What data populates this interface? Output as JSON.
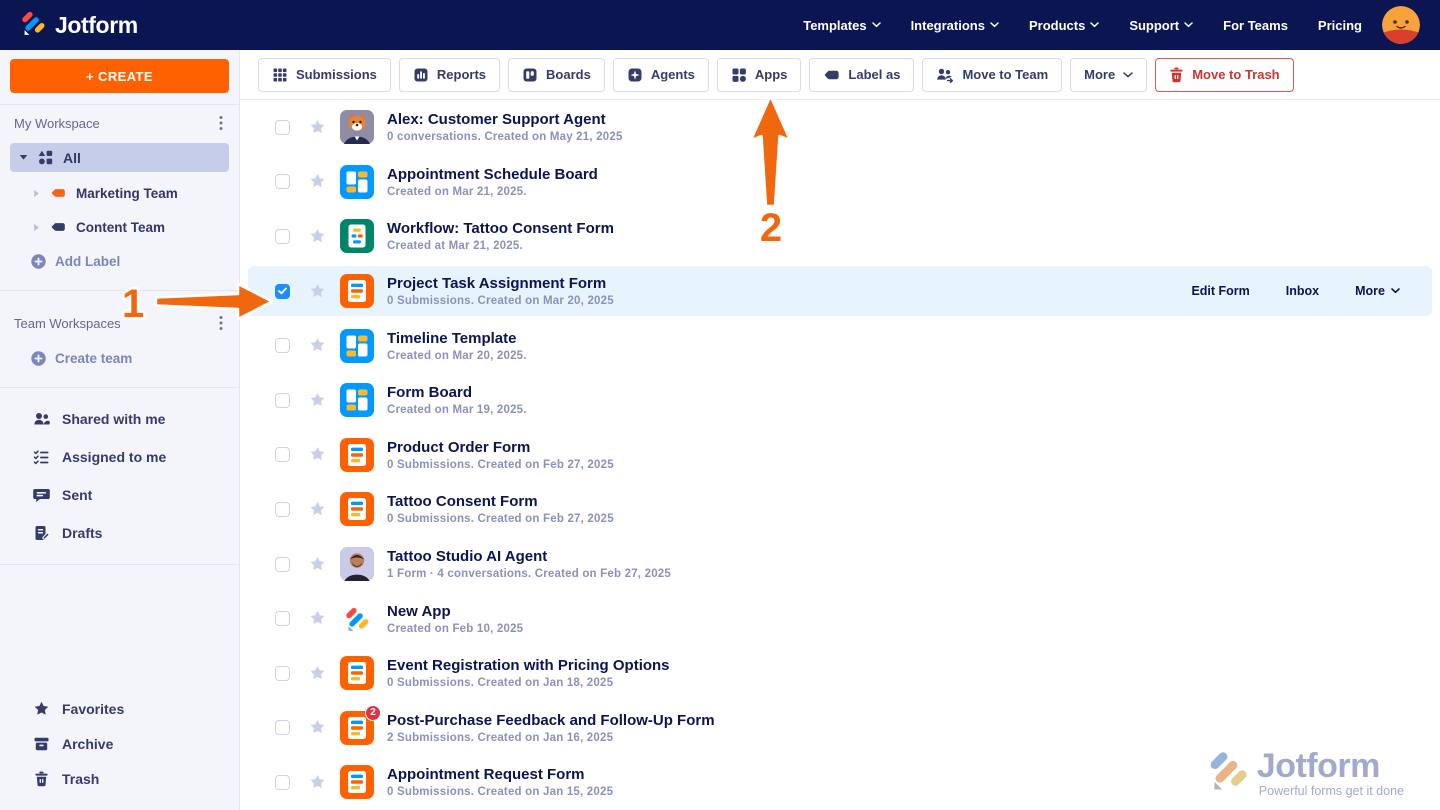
{
  "header": {
    "brand": "Jotform",
    "nav": [
      {
        "label": "Templates",
        "chevron": true
      },
      {
        "label": "Integrations",
        "chevron": true
      },
      {
        "label": "Products",
        "chevron": true
      },
      {
        "label": "Support",
        "chevron": true
      },
      {
        "label": "For Teams",
        "chevron": false
      },
      {
        "label": "Pricing",
        "chevron": false
      }
    ]
  },
  "sidebar": {
    "create_label": "+ CREATE",
    "my_workspace_title": "My Workspace",
    "all_label": "All",
    "marketing_label": "Marketing Team",
    "content_label": "Content Team",
    "add_label": "Add Label",
    "team_workspaces_title": "Team Workspaces",
    "create_team_label": "Create team",
    "links": {
      "shared": "Shared with me",
      "assigned": "Assigned to me",
      "sent": "Sent",
      "drafts": "Drafts",
      "favorites": "Favorites",
      "archive": "Archive",
      "trash": "Trash"
    }
  },
  "toolbar": {
    "submissions": "Submissions",
    "reports": "Reports",
    "boards": "Boards",
    "agents": "Agents",
    "apps": "Apps",
    "label_as": "Label as",
    "move_to_team": "Move to Team",
    "more": "More",
    "move_to_trash": "Move to Trash"
  },
  "rows": [
    {
      "icon": "agent-avatar-fox",
      "title": "Alex: Customer Support Agent",
      "subtitle": "0 conversations. Created on May 21, 2025",
      "checked": false,
      "selected": false
    },
    {
      "icon": "board",
      "title": "Appointment Schedule Board",
      "subtitle": "Created on Mar 21, 2025.",
      "checked": false,
      "selected": false
    },
    {
      "icon": "workflow",
      "title": "Workflow: Tattoo Consent Form",
      "subtitle": "Created at Mar 21, 2025.",
      "checked": false,
      "selected": false
    },
    {
      "icon": "form",
      "title": "Project Task Assignment Form",
      "subtitle": "0 Submissions. Created on Mar 20, 2025",
      "checked": true,
      "selected": true,
      "actions": {
        "edit": "Edit Form",
        "inbox": "Inbox",
        "more": "More"
      }
    },
    {
      "icon": "board",
      "title": "Timeline Template",
      "subtitle": "Created on Mar 20, 2025.",
      "checked": false,
      "selected": false
    },
    {
      "icon": "board",
      "title": "Form Board",
      "subtitle": "Created on Mar 19, 2025.",
      "checked": false,
      "selected": false
    },
    {
      "icon": "form",
      "title": "Product Order Form",
      "subtitle": "0 Submissions. Created on Feb 27, 2025",
      "checked": false,
      "selected": false
    },
    {
      "icon": "form",
      "title": "Tattoo Consent Form",
      "subtitle": "0 Submissions. Created on Feb 27, 2025",
      "checked": false,
      "selected": false
    },
    {
      "icon": "agent-avatar-man",
      "title": "Tattoo Studio AI Agent",
      "subtitle": "1 Form · 4 conversations. Created on Feb 27, 2025",
      "checked": false,
      "selected": false
    },
    {
      "icon": "jotform-logo",
      "title": "New App",
      "subtitle": "Created on Feb 10, 2025",
      "checked": false,
      "selected": false
    },
    {
      "icon": "form",
      "title": "Event Registration with Pricing Options",
      "subtitle": "0 Submissions. Created on Jan 18, 2025",
      "checked": false,
      "selected": false
    },
    {
      "icon": "form",
      "title": "Post-Purchase Feedback and Follow-Up Form",
      "subtitle": "2 Submissions. Created on Jan 16, 2025",
      "checked": false,
      "selected": false,
      "badge": "2"
    },
    {
      "icon": "form",
      "title": "Appointment Request Form",
      "subtitle": "0 Submissions. Created on Jan 15, 2025",
      "checked": false,
      "selected": false
    }
  ],
  "annotations": {
    "step1": "1",
    "step2": "2"
  },
  "watermark": {
    "brand": "Jotform",
    "tagline": "Powerful forms get it done"
  },
  "colors": {
    "brand_navy": "#0a1551",
    "brand_orange": "#ff6100",
    "link_blue": "#0099ff",
    "danger_red": "#d0342c",
    "annotation_orange": "#f0680d",
    "selected_row_bg": "#e8f4fd",
    "sidebar_selected_bg": "#c6cdea"
  }
}
